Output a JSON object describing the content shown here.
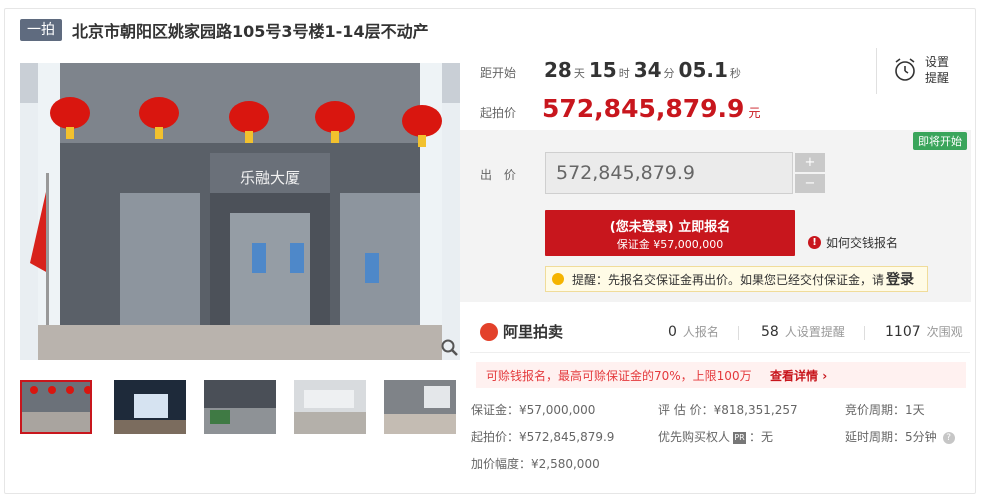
{
  "header": {
    "tag": "一拍",
    "title": "北京市朝阳区姚家园路105号3号楼1-14层不动产"
  },
  "photo": {
    "sign_text": "乐融大厦"
  },
  "countdown": {
    "label": "距开始",
    "days": "28",
    "days_unit": "天",
    "hours": "15",
    "hours_unit": "时",
    "minutes": "34",
    "minutes_unit": "分",
    "seconds": "05.1",
    "seconds_unit": "秒"
  },
  "start_price": {
    "label": "起拍价",
    "value": "572,845,879.9",
    "unit": "元"
  },
  "remind": {
    "label": "设置提醒"
  },
  "bid": {
    "status_badge": "即将开始",
    "label": "出 价",
    "value": "572,845,879.9",
    "plus": "+",
    "minus": "−",
    "signup_line1": "(您未登录) 立即报名",
    "signup_line2": "保证金 ¥57,000,000",
    "how_pay": "如何交钱报名",
    "tip_text": "提醒：先报名交保证金再出价。如果您已经交付保证金，请",
    "tip_link": "登录"
  },
  "stats": {
    "brand": "阿里拍卖",
    "signups_num": "0",
    "signups_label": "人报名",
    "reminders_num": "58",
    "reminders_label": "人设置提醒",
    "views_num": "1107",
    "views_label": "次围观"
  },
  "promo": {
    "text": "可赊钱报名，最高可赊保证金的70%，上限100万",
    "link": "查看详情"
  },
  "meta": {
    "deposit": "保证金：¥57,000,000",
    "appraisal": "评 估 价：¥818,351,257",
    "auction_period": "竞价周期：1天",
    "start_price": "起拍价：¥572,845,879.9",
    "priority_label": "优先购买权人",
    "priority_badge": "PR",
    "priority_value": "：无",
    "extension_period": "延时周期：5分钟",
    "increment": "加价幅度：¥2,580,000"
  },
  "colors": {
    "accent": "#c8161d",
    "badge_green": "#3aa55b",
    "tag_bg": "#5f6b7f"
  }
}
